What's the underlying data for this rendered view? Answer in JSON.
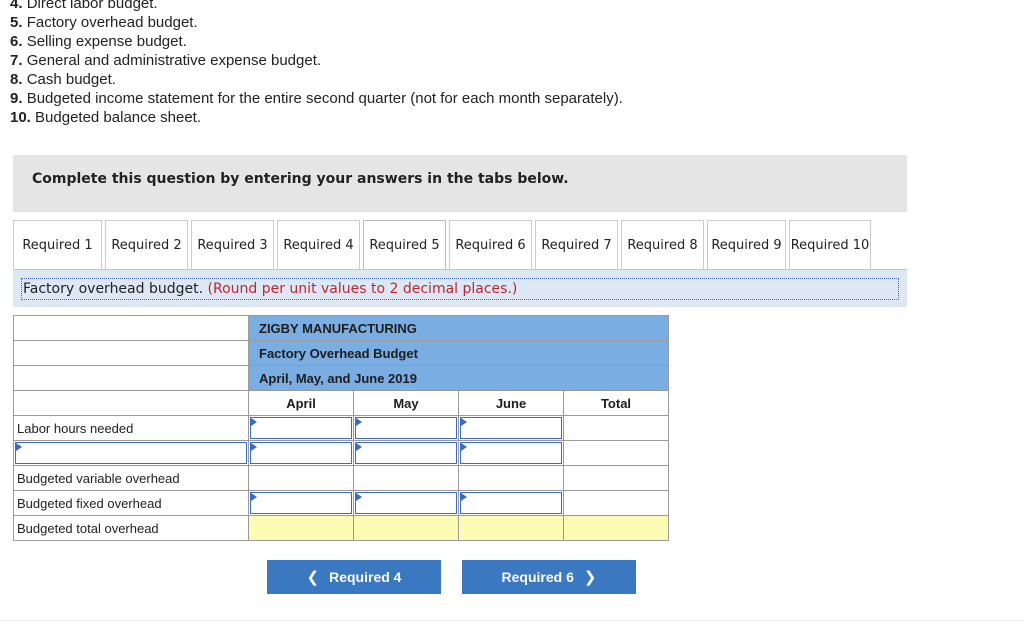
{
  "requirements": [
    {
      "num": "4.",
      "text": "Direct labor budget."
    },
    {
      "num": "5.",
      "text": "Factory overhead budget."
    },
    {
      "num": "6.",
      "text": "Selling expense budget."
    },
    {
      "num": "7.",
      "text": "General and administrative expense budget."
    },
    {
      "num": "8.",
      "text": "Cash budget."
    },
    {
      "num": "9.",
      "text": "Budgeted income statement for the entire second quarter (not for each month separately)."
    },
    {
      "num": "10.",
      "text": "Budgeted balance sheet."
    }
  ],
  "instruction": "Complete this question by entering your answers in the tabs below.",
  "tabs": [
    "Required 1",
    "Required 2",
    "Required 3",
    "Required 4",
    "Required 5",
    "Required 6",
    "Required 7",
    "Required 8",
    "Required 9",
    "Required 10"
  ],
  "active_tab": "Required 5",
  "panel": {
    "title": "Factory overhead budget.",
    "note": "(Round per unit values to 2 decimal places.)"
  },
  "table": {
    "company": "ZIGBY MANUFACTURING",
    "budget_name": "Factory Overhead Budget",
    "period": "April, May, and June 2019",
    "columns": [
      "April",
      "May",
      "June",
      "Total"
    ],
    "rows": [
      {
        "label": "Labor hours needed"
      },
      {
        "label": ""
      },
      {
        "label": "Budgeted variable overhead"
      },
      {
        "label": "Budgeted fixed overhead"
      },
      {
        "label": "Budgeted total overhead"
      }
    ]
  },
  "nav": {
    "prev_label": "Required 4",
    "next_label": "Required 6",
    "prev_icon": "chevron-left-icon",
    "next_icon": "chevron-right-icon"
  },
  "colors": {
    "header_blue": "#7aade2",
    "button_blue": "#3a78c2",
    "note_red": "#c0262d",
    "total_yellow": "#fdfcb4"
  }
}
